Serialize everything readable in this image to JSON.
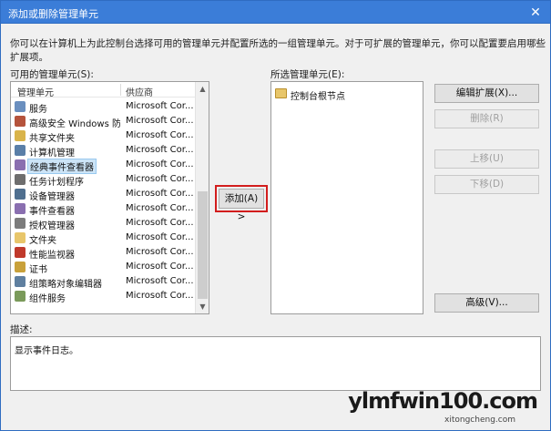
{
  "window": {
    "title": "添加或删除管理单元",
    "close_glyph": "✕"
  },
  "instructions": "你可以在计算机上为此控制台选择可用的管理单元并配置所选的一组管理单元。对于可扩展的管理单元，你可以配置要启用哪些扩展项。",
  "available": {
    "label": "可用的管理单元(S):",
    "headers": {
      "name": "管理单元",
      "vendor": "供应商"
    },
    "items": [
      {
        "name": "服务",
        "vendor": "Microsoft Cor...",
        "icon": "gears-icon",
        "color": "#6a8fbf"
      },
      {
        "name": "高级安全 Windows 防...",
        "vendor": "Microsoft Cor...",
        "icon": "firewall-icon",
        "color": "#b5533c"
      },
      {
        "name": "共享文件夹",
        "vendor": "Microsoft Cor...",
        "icon": "shared-folder-icon",
        "color": "#d9b44a"
      },
      {
        "name": "计算机管理",
        "vendor": "Microsoft Cor...",
        "icon": "computer-management-icon",
        "color": "#5a7fa8"
      },
      {
        "name": "经典事件查看器",
        "vendor": "Microsoft Cor...",
        "icon": "event-viewer-icon",
        "color": "#8a6fb0"
      },
      {
        "name": "任务计划程序",
        "vendor": "Microsoft Cor...",
        "icon": "clock-icon",
        "color": "#6e6e6e"
      },
      {
        "name": "设备管理器",
        "vendor": "Microsoft Cor...",
        "icon": "device-manager-icon",
        "color": "#4f6f8f"
      },
      {
        "name": "事件查看器",
        "vendor": "Microsoft Cor...",
        "icon": "event-log-icon",
        "color": "#8a6fb0"
      },
      {
        "name": "授权管理器",
        "vendor": "Microsoft Cor...",
        "icon": "authorization-icon",
        "color": "#7c7c7c"
      },
      {
        "name": "文件夹",
        "vendor": "Microsoft Cor...",
        "icon": "folder-icon",
        "color": "#e8c66a"
      },
      {
        "name": "性能监视器",
        "vendor": "Microsoft Cor...",
        "icon": "performance-icon",
        "color": "#c0392b"
      },
      {
        "name": "证书",
        "vendor": "Microsoft Cor...",
        "icon": "certificate-icon",
        "color": "#c9a13a"
      },
      {
        "name": "组策略对象编辑器",
        "vendor": "Microsoft Cor...",
        "icon": "group-policy-icon",
        "color": "#5f7f9f"
      },
      {
        "name": "组件服务",
        "vendor": "Microsoft Cor...",
        "icon": "component-services-icon",
        "color": "#7a9a5a"
      }
    ]
  },
  "buttons": {
    "add": "添加(A) >",
    "edit_extensions": "编辑扩展(X)...",
    "remove": "删除(R)",
    "move_up": "上移(U)",
    "move_down": "下移(D)",
    "advanced": "高级(V)..."
  },
  "selected": {
    "label": "所选管理单元(E):",
    "root_node": "控制台根节点"
  },
  "description": {
    "label": "描述:",
    "text": "显示事件日志。"
  },
  "watermark": {
    "main": "ylmfwin100.com",
    "sub": "xitongcheng.com"
  }
}
